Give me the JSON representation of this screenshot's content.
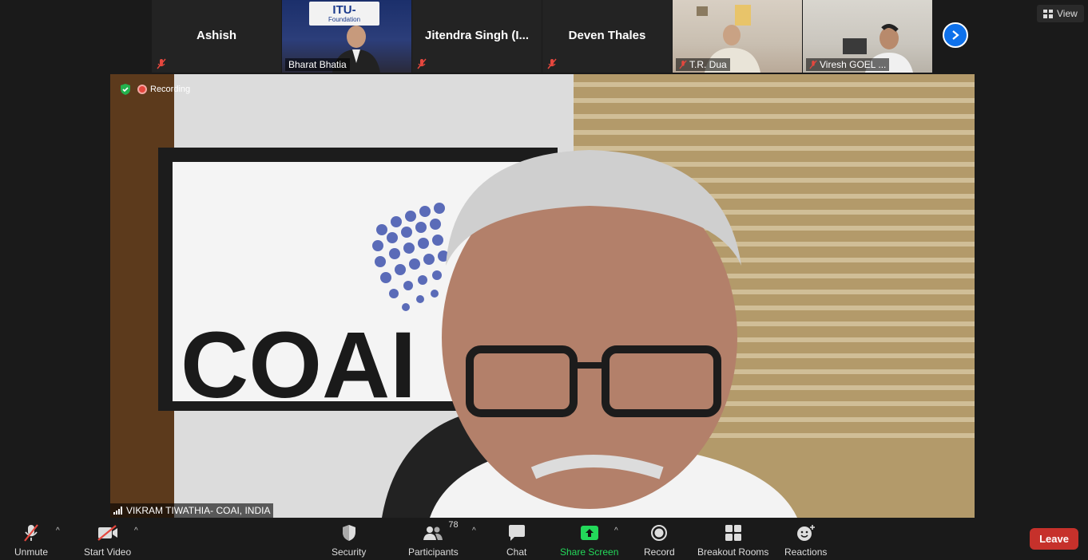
{
  "participants_strip": [
    {
      "name": "Ashish",
      "video": false,
      "muted": true
    },
    {
      "name": "Bharat Bhatia",
      "video": true,
      "muted": false,
      "logo_text": "ITU-",
      "logo_sub": "Foundation"
    },
    {
      "name": "Jitendra Singh (I...",
      "video": false,
      "muted": true
    },
    {
      "name": "Deven Thales",
      "video": false,
      "muted": true
    },
    {
      "name": "T.R. Dua",
      "video": true,
      "muted": true
    },
    {
      "name": "Viresh GOEL ...",
      "video": true,
      "muted": true
    }
  ],
  "view_label": "View",
  "main_video": {
    "recording_label": "Recording",
    "speaker_name": "VIKRAM TIWATHIA- COAI, INDIA",
    "backdrop_text": "COAI"
  },
  "toolbar": {
    "unmute": "Unmute",
    "start_video": "Start Video",
    "security": "Security",
    "participants": "Participants",
    "participants_count": "78",
    "chat": "Chat",
    "share_screen": "Share Screen",
    "record": "Record",
    "breakout_rooms": "Breakout Rooms",
    "reactions": "Reactions",
    "leave": "Leave"
  },
  "colors": {
    "accent_blue": "#0e71eb",
    "leave_red": "#c6312b",
    "share_green": "#23d95a",
    "muted_red": "#e5473e"
  }
}
